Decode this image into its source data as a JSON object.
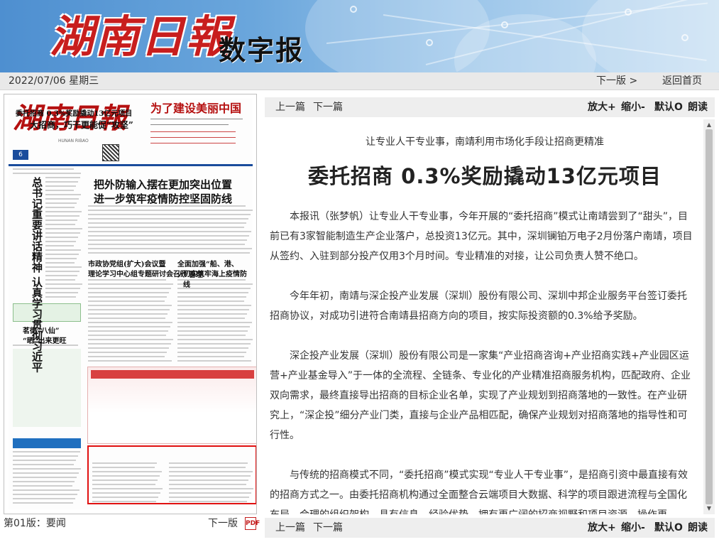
{
  "banner": {
    "logo": "湖南日報",
    "subtitle": "数字报"
  },
  "datebar": {
    "date": "2022/07/06 星期三",
    "next_page": "下一版 >",
    "home": "返回首页"
  },
  "thumbnail": {
    "masthead": "湖南日報",
    "masthead_pinyin": "HUNAN RIBAO",
    "headline_top": "为了建设美丽中国",
    "lead_headline_1": "把外防输入摆在更加突出位置",
    "lead_headline_2": "进一步筑牢疫情防控坚固防线",
    "side_headline": "总书记重要讲话精神 认真学习贯彻习近平",
    "mid_headline_1": "市政协党组(扩大)会议暨",
    "mid_headline_2": "理论学习中心组专题研讨会召开",
    "mid_headline_3": "全面加强“船、港、人”管理",
    "mid_headline_4": "切实筑牢海上疫情防线",
    "left_box_1": "茗街“八仙”",
    "left_box_2": "“晒”出来更旺",
    "ad_headline": "大招商，巧干更能促“攻坚”",
    "highlight_headline": "委托招商 0.3%奖励撬动13亿元项目",
    "page_number": "6"
  },
  "thumb_footer": {
    "page_label": "第01版：要闻",
    "next": "下一版",
    "pdf_icon": "pdf-icon"
  },
  "toolbar": {
    "prev_article": "上一篇",
    "next_article": "下一篇",
    "zoom_in": "放大+",
    "zoom_out": "缩小-",
    "default": "默认O",
    "read_aloud": "朗读"
  },
  "article": {
    "subtitle": "让专业人干专业事，南靖利用市场化手段让招商更精准",
    "headline": "委托招商 0.3%奖励撬动13亿元项目",
    "paragraphs": [
      "本报讯（张梦帆）让专业人干专业事，今年开展的“委托招商”模式让南靖尝到了“甜头”，目前已有3家智能制造生产企业落户，总投资13亿元。其中，深圳镧铂万电子2月份落户南靖，项目从签约、入驻到部分投产仅用3个月时间。专业精准的对接，让公司负责人赞不绝口。",
      "今年年初，南靖与深企投产业发展（深圳）股份有限公司、深圳中邦企业服务平台签订委托招商协议，对成功引进符合南靖县招商方向的项目，按实际投资额的0.3%给予奖励。",
      "深企投产业发展（深圳）股份有限公司是一家集“产业招商咨询+产业招商实践+产业园区运营+产业基金导入”于一体的全流程、全链条、专业化的产业精准招商服务机构，匹配政府、企业双向需求，最终直接导出招商的目标企业名单，实现了产业规划到招商落地的一致性。在产业研究上，“深企投”细分产业门类，直接与企业产品相匹配，确保产业规划对招商落地的指导性和可行性。",
      "与传统的招商模式不同，“委托招商”模式实现“专业人干专业事”，是招商引资中最直接有效的招商方式之一。由委托招商机构通过全面整合云端项目大数据、科学的项目跟进流程与全国化布局、合理的组织架构，具有信息、经验优势，拥有更广阔的招商视野和项目资源，操作更"
    ]
  }
}
